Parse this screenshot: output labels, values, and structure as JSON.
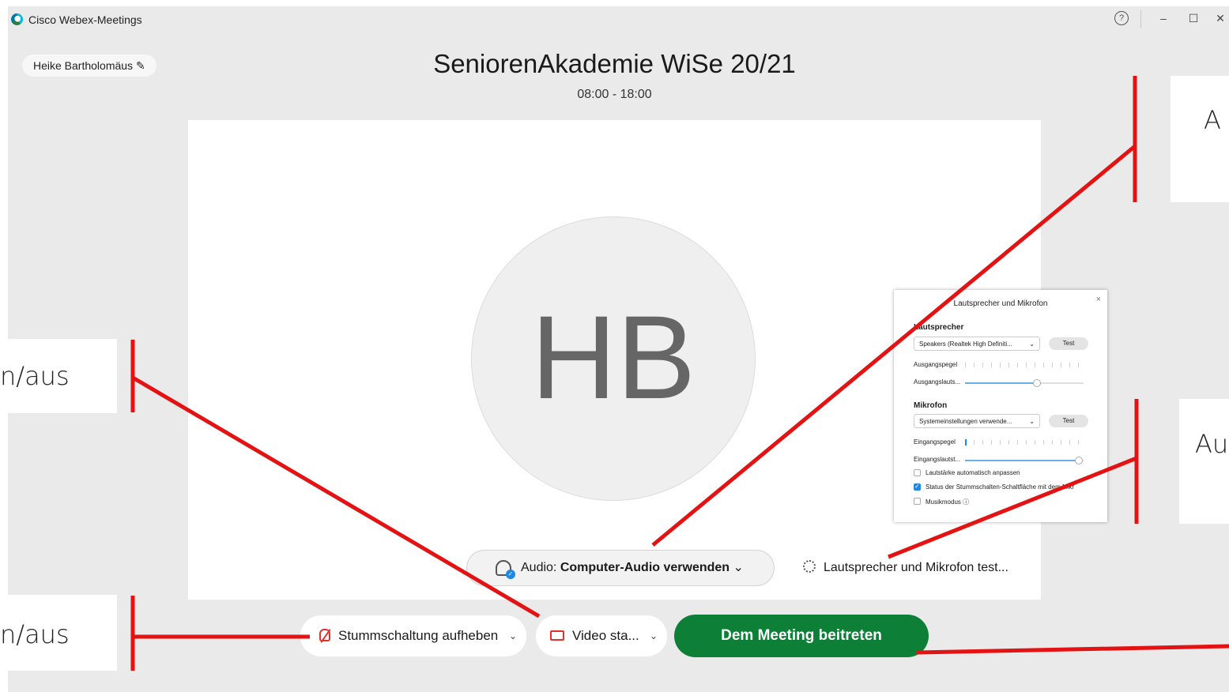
{
  "window": {
    "title": "Cisco Webex-Meetings",
    "help_icon": "question-circle-icon",
    "minimize": "–",
    "maximize": "☐",
    "close": "✕"
  },
  "user": {
    "name": "Heike Bartholomäus",
    "edit_icon": "✎"
  },
  "meeting": {
    "title": "SeniorenAkademie WiSe 20/21",
    "time": "08:00 - 18:00"
  },
  "avatar": {
    "initials": "HB"
  },
  "audio_settings_popup": {
    "title": "Lautsprecher und Mikrofon",
    "close": "×",
    "speaker_heading": "Lautsprecher",
    "speaker_device": "Speakers (Realtek High Definiti...",
    "speaker_test": "Test",
    "output_level_label": "Ausgangspegel",
    "output_volume_label": "Ausgangslauts...",
    "output_volume": 0.6,
    "mic_heading": "Mikrofon",
    "mic_device": "Systemeinstellungen verwende...",
    "mic_test": "Test",
    "input_level_label": "Eingangspegel",
    "input_volume_label": "Eingangslautst...",
    "input_volume": 0.95,
    "auto_adjust_label": "Lautstärke automatisch anpassen",
    "auto_adjust": false,
    "sync_mute_label": "Status der Stummschalten-Schaltfläche mit dem Mikr",
    "sync_mute": true,
    "music_mode_label": "Musikmodus ⓘ",
    "music_mode": false,
    "chevron": "⌄"
  },
  "audio_selector": {
    "prefix": "Audio:",
    "value": "Computer-Audio verwenden",
    "chevron": "⌄"
  },
  "speaker_test_link": "Lautsprecher und Mikrofon test...",
  "controls": {
    "unmute_label": "Stummschaltung aufheben",
    "video_label": "Video sta...",
    "chevron": "⌄",
    "join_label": "Dem Meeting beitreten"
  },
  "callouts": {
    "top_right": "A",
    "left_middle": "n/aus",
    "right_middle": "Au",
    "left_bottom": "n/aus"
  },
  "colors": {
    "accent": "#0e7f37",
    "annotation": "#e31313",
    "muted_icon": "#e0312f"
  }
}
